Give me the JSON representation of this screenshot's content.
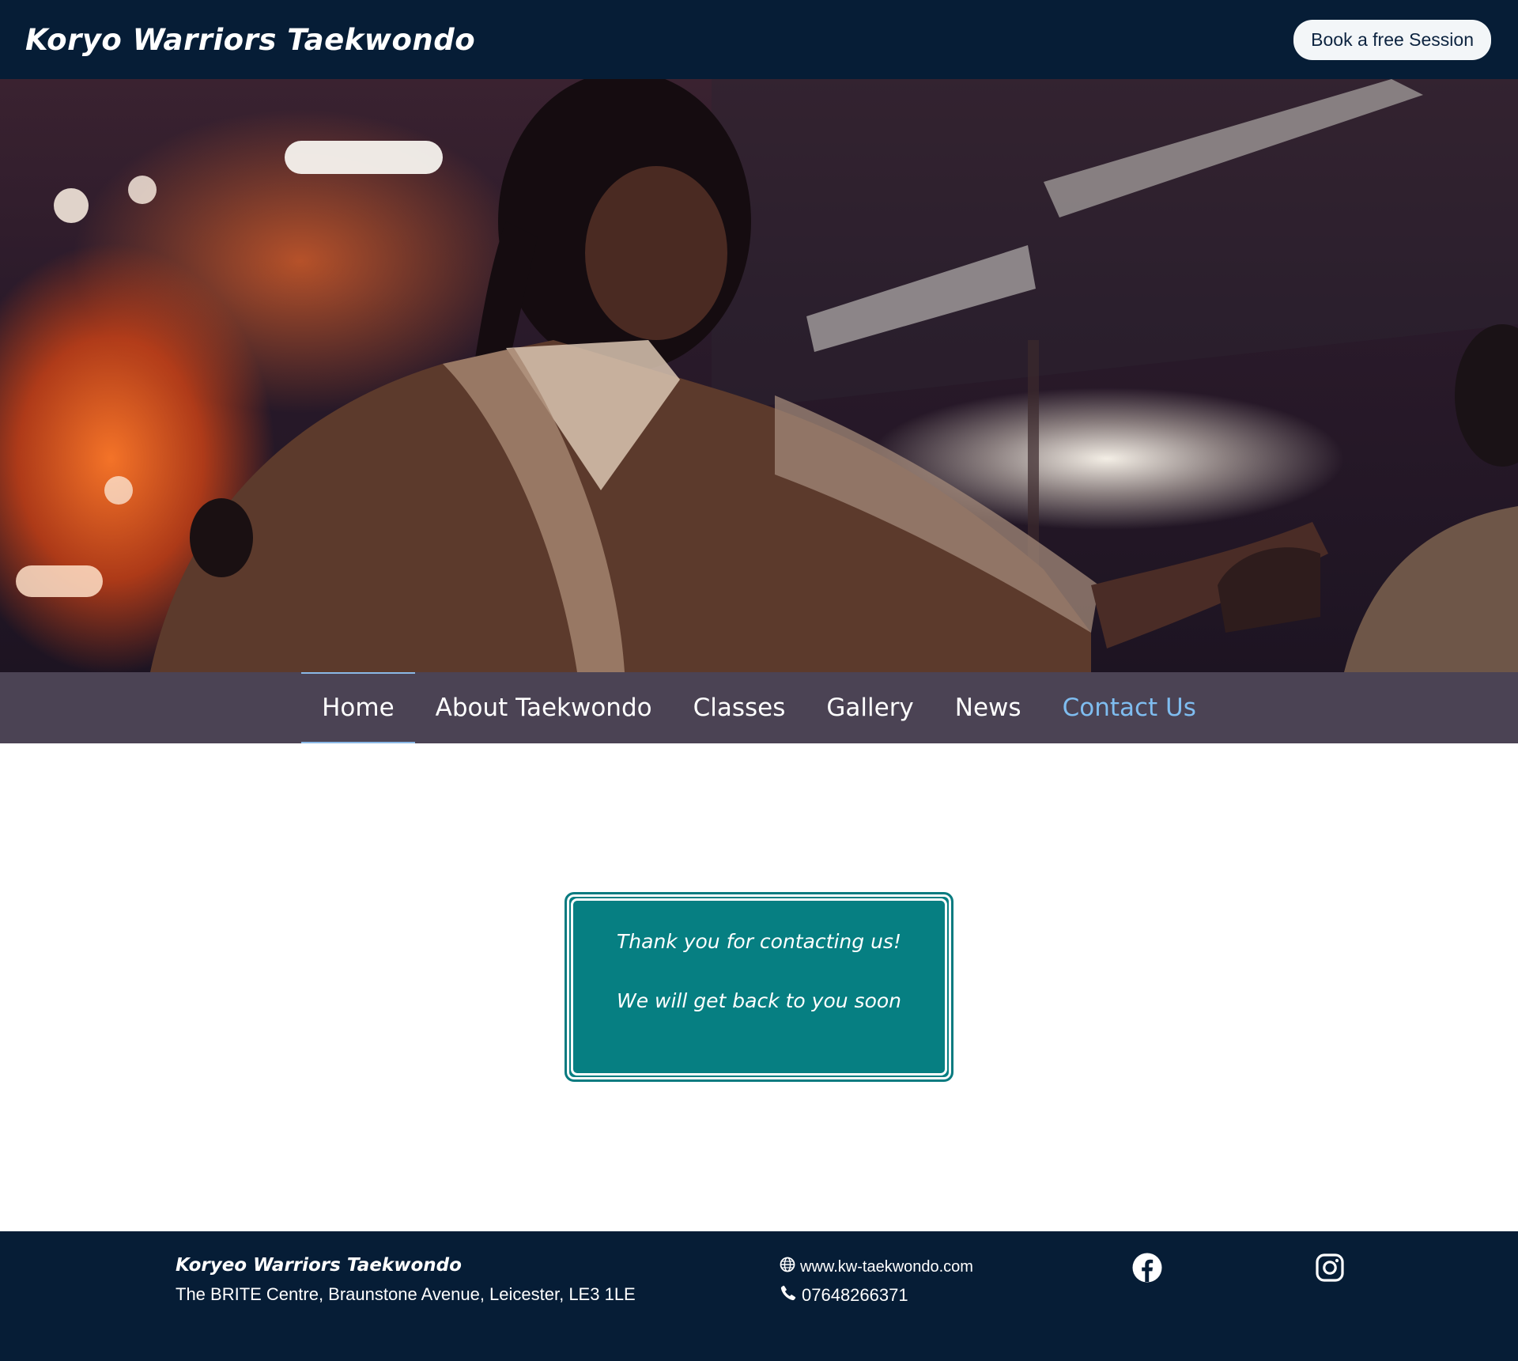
{
  "header": {
    "brand": "Koryo Warriors Taekwondo",
    "book_button": "Book a free Session"
  },
  "hero": {
    "image": "taekwondo-student-in-dobok-photo"
  },
  "nav": {
    "items": [
      {
        "label": "Home",
        "state": "active"
      },
      {
        "label": "About Taekwondo"
      },
      {
        "label": "Classes"
      },
      {
        "label": "Gallery"
      },
      {
        "label": "News"
      },
      {
        "label": "Contact Us",
        "state": "current-page"
      }
    ]
  },
  "main": {
    "thanks_line1": "Thank you for contacting us!",
    "thanks_line2": "We will get back to you soon"
  },
  "footer": {
    "brand": "Koryeo Warriors Taekwondo",
    "address": "The BRITE Centre, Braunstone Avenue, Leicester, LE3 1LE",
    "website": "www.kw-taekwondo.com",
    "phone": "07648266371",
    "icons": [
      "globe-icon",
      "phone-icon",
      "facebook-icon",
      "instagram-icon"
    ]
  },
  "colors": {
    "header_bg": "#061d36",
    "nav_bg": "#4b4354",
    "nav_active_link": "#7fbdf0",
    "box_teal": "#067f82"
  }
}
